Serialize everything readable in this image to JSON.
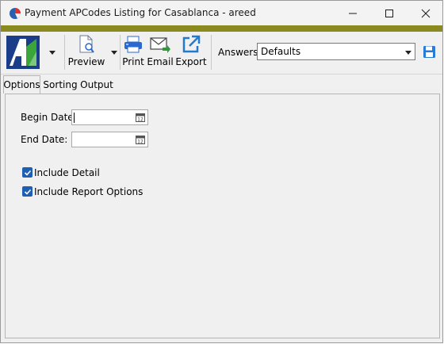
{
  "window": {
    "title": "Payment APCodes Listing for Casablanca - areed"
  },
  "toolbar": {
    "preview_label": "Preview",
    "print_label": "Print",
    "email_label": "Email",
    "export_label": "Export",
    "answers_label": "Answers:",
    "answers_value": "Defaults"
  },
  "tabs": [
    {
      "label": "Options"
    },
    {
      "label": "Sorting"
    },
    {
      "label": "Output"
    }
  ],
  "options": {
    "begin_date_label": "Begin Date:",
    "begin_date_value": "",
    "end_date_label": "End Date:",
    "end_date_value": "",
    "include_detail_label": "Include Detail",
    "include_detail_checked": true,
    "include_report_options_label": "Include Report Options",
    "include_report_options_checked": true
  },
  "colors": {
    "accent": "#8a8a1e",
    "checkbox": "#1f5fb3",
    "logo_blue": "#1a3d8a",
    "logo_green": "#3aa63a"
  }
}
